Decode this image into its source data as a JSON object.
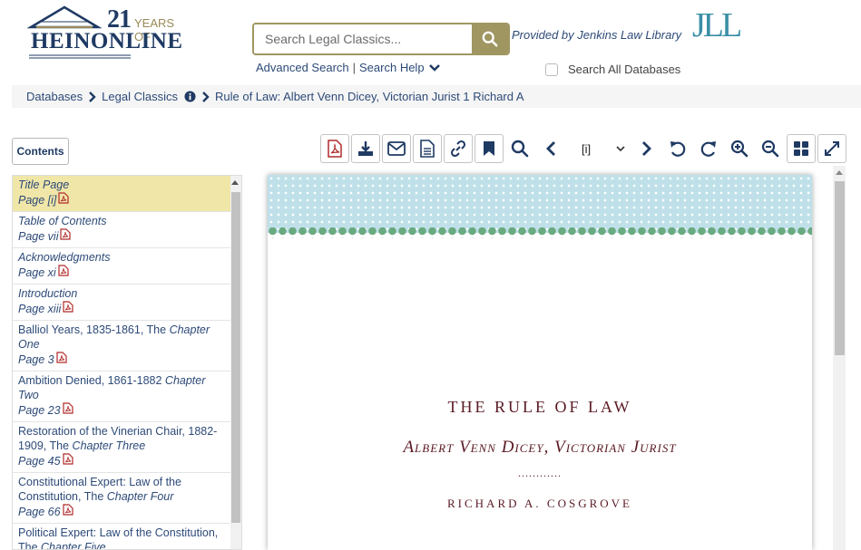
{
  "logo": {
    "years_number": "21",
    "years_text": "YEARS OF",
    "name": "HEINONLINE"
  },
  "search": {
    "placeholder": "Search Legal Classics...",
    "advanced_label": "Advanced Search",
    "separator": "|",
    "help_label": "Search Help",
    "search_all_label": "Search All Databases"
  },
  "provider": {
    "text": "Provided by Jenkins Law Library",
    "logo_text": "JLL"
  },
  "breadcrumb": {
    "items": [
      "Databases",
      "Legal Classics",
      "Rule of Law: Albert Venn Dicey, Victorian Jurist 1 Richard A"
    ]
  },
  "contents_label": "Contents",
  "toolbar": {
    "page_value": "[i]",
    "icons": [
      "pdf-icon",
      "download-icon",
      "email-icon",
      "text-icon",
      "link-icon",
      "bookmark-icon",
      "search-icon",
      "prev-page-icon",
      "next-page-icon",
      "rotate-left-icon",
      "rotate-right-icon",
      "zoom-in-icon",
      "zoom-out-icon",
      "grid-view-icon",
      "fullscreen-icon"
    ]
  },
  "toc": [
    {
      "title": "Title Page",
      "chapter": "",
      "page": "Page [i]",
      "italic": true,
      "active": true
    },
    {
      "title": "Table of Contents",
      "chapter": "",
      "page": "Page vii",
      "italic": true,
      "active": false
    },
    {
      "title": "Acknowledgments",
      "chapter": "",
      "page": "Page xi",
      "italic": true,
      "active": false
    },
    {
      "title": "Introduction",
      "chapter": "",
      "page": "Page xiii",
      "italic": true,
      "active": false
    },
    {
      "title": "Balliol Years, 1835-1861, The ",
      "chapter": "Chapter One",
      "page": "Page 3",
      "italic": false,
      "active": false
    },
    {
      "title": "Ambition Denied, 1861-1882 ",
      "chapter": "Chapter Two",
      "page": "Page 23",
      "italic": false,
      "active": false
    },
    {
      "title": "Restoration of the Vinerian Chair, 1882-1909, The ",
      "chapter": "Chapter Three",
      "page": "Page 45",
      "italic": false,
      "active": false
    },
    {
      "title": "Constitutional Expert: Law of the Constitution, The ",
      "chapter": "Chapter Four",
      "page": "Page 66",
      "italic": false,
      "active": false
    },
    {
      "title": "Political Expert: Law of the Constitution, The ",
      "chapter": "Chapter Five",
      "page": "",
      "italic": false,
      "active": false
    }
  ],
  "page_content": {
    "line1": "THE RULE OF LAW",
    "line2": "Albert Venn Dicey, Victorian Jurist",
    "line3": "............",
    "line4": "RICHARD A. COSGROVE"
  }
}
